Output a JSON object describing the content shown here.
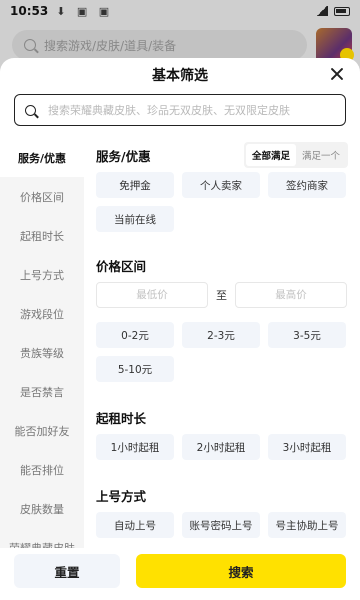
{
  "status_bar": {
    "time": "10:53",
    "icons": "⬇ ▣ ▣"
  },
  "background": {
    "search_placeholder": "搜索游戏/皮肤/道具/装备"
  },
  "sheet": {
    "title": "基本筛选",
    "search_placeholder": "搜索荣耀典藏皮肤、珍品无双皮肤、无双限定皮肤"
  },
  "sidebar": {
    "items": [
      {
        "label": "服务/优惠"
      },
      {
        "label": "价格区间"
      },
      {
        "label": "起租时长"
      },
      {
        "label": "上号方式"
      },
      {
        "label": "游戏段位"
      },
      {
        "label": "贵族等级"
      },
      {
        "label": "是否禁言"
      },
      {
        "label": "能否加好友"
      },
      {
        "label": "能否排位"
      },
      {
        "label": "皮肤数量"
      },
      {
        "label": "荣耀典藏皮肤"
      }
    ]
  },
  "sections": {
    "service": {
      "title": "服务/优惠",
      "toggle": [
        "全部满足",
        "满足一个"
      ],
      "options": [
        "免押金",
        "个人卖家",
        "签约商家",
        "当前在线"
      ]
    },
    "price": {
      "title": "价格区间",
      "min_placeholder": "最低价",
      "max_placeholder": "最高价",
      "separator": "至",
      "options": [
        "0-2元",
        "2-3元",
        "3-5元",
        "5-10元"
      ]
    },
    "duration": {
      "title": "起租时长",
      "options": [
        "1小时起租",
        "2小时起租",
        "3小时起租"
      ]
    },
    "login": {
      "title": "上号方式",
      "options": [
        "自动上号",
        "账号密码上号",
        "号主协助上号"
      ]
    }
  },
  "buttons": {
    "reset": "重置",
    "search": "搜索"
  },
  "colors": {
    "accent": "#ffe100",
    "chip_bg": "#f2f5fa",
    "sidebar_bg": "#f5f5f5"
  }
}
